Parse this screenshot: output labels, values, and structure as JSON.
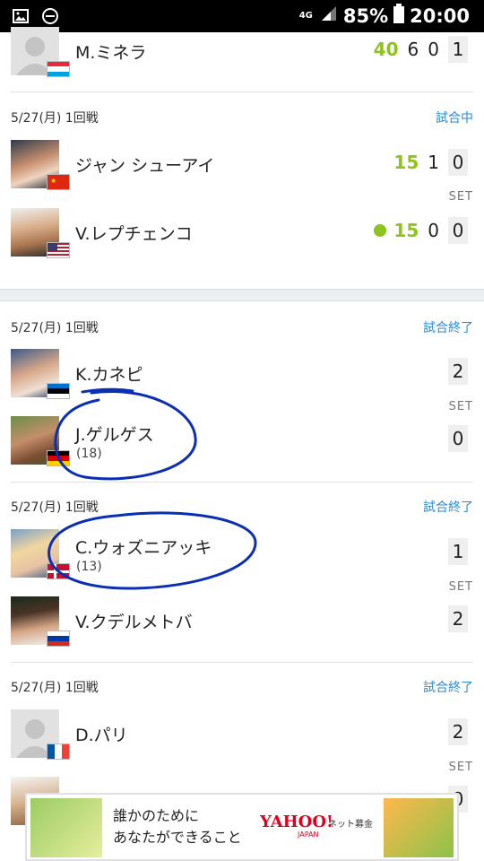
{
  "status_bar": {
    "network": "4G",
    "battery": "85%",
    "time": "20:00"
  },
  "set_label": "SET",
  "match_top": {
    "player": {
      "name": "M.ミネラ",
      "points": "40",
      "games": "6",
      "g2": "0",
      "sets": "1",
      "flag": "luxembourg"
    }
  },
  "match1": {
    "date": "5/27(月) 1回戦",
    "status": "試合中",
    "p1": {
      "name": "ジャン シューアイ",
      "points": "15",
      "games": "1",
      "sets": "0",
      "flag": "china"
    },
    "p2": {
      "name": "V.レプチェンコ",
      "points": "15",
      "games": "0",
      "sets": "0",
      "flag": "usa",
      "serving": true
    }
  },
  "match2": {
    "date": "5/27(月) 1回戦",
    "status": "試合終了",
    "p1": {
      "name": "K.カネピ",
      "sets": "2",
      "flag": "estonia"
    },
    "p2": {
      "name": "J.ゲルゲス",
      "seed": "(18)",
      "sets": "0",
      "flag": "germany"
    }
  },
  "match3": {
    "date": "5/27(月) 1回戦",
    "status": "試合終了",
    "p1": {
      "name": "C.ウォズニアッキ",
      "seed": "(13)",
      "sets": "1",
      "flag": "denmark"
    },
    "p2": {
      "name": "V.クデルメトバ",
      "sets": "2",
      "flag": "russia"
    }
  },
  "match4": {
    "date": "5/27(月) 1回戦",
    "status": "試合終了",
    "p1": {
      "name": "D.パリ",
      "sets": "2",
      "flag": "france"
    },
    "p2": {
      "sets": "0"
    }
  },
  "ad": {
    "line1": "誰かのために",
    "line2": "あなたができること",
    "logo": "YAHOO!",
    "logo_sub": "JAPAN",
    "logo_net": "ネット募金"
  },
  "colors": {
    "accent": "#2c8ad3",
    "points_green": "#8cc31f",
    "annotation": "#0a2fb3"
  }
}
